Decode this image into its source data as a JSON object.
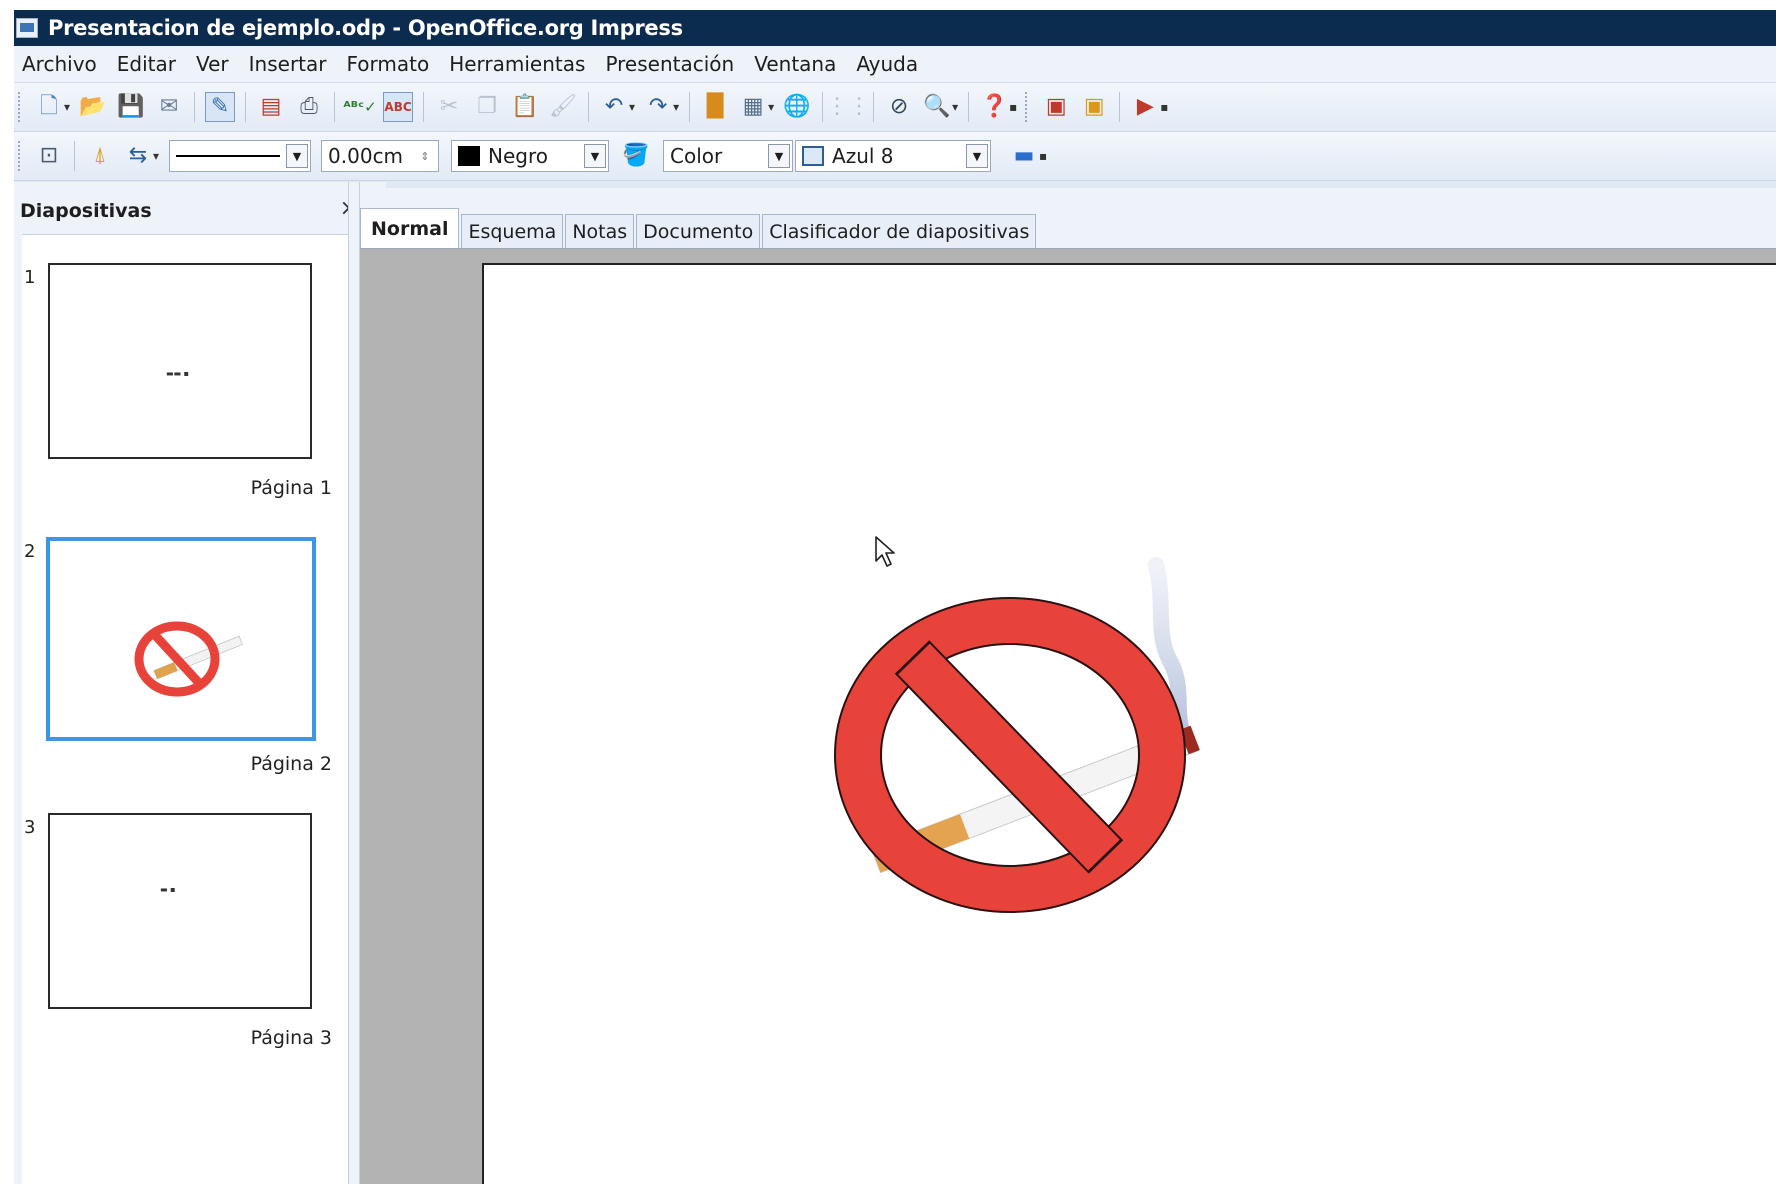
{
  "window": {
    "title": "Presentacion de ejemplo.odp - OpenOffice.org Impress"
  },
  "menu": [
    "Archivo",
    "Editar",
    "Ver",
    "Insertar",
    "Formato",
    "Herramientas",
    "Presentación",
    "Ventana",
    "Ayuda"
  ],
  "line_toolbar": {
    "line_width": "0.00cm",
    "line_color": "Negro",
    "area_style": "Color",
    "area_color": "Azul 8",
    "colors": {
      "line_color_swatch": "#000000",
      "area_color_swatch": "#dbe8f5"
    }
  },
  "panel": {
    "title": "Diapositivas",
    "close": "×",
    "slides": [
      {
        "number": "1",
        "page": "Página 1"
      },
      {
        "number": "2",
        "page": "Página 2"
      },
      {
        "number": "3",
        "page": "Página 3"
      }
    ]
  },
  "tabs": [
    "Normal",
    "Esquema",
    "Notas",
    "Documento",
    "Clasificador de diapositivas"
  ],
  "colors": {
    "titlebar": "#0c2c4f",
    "selection": "#3c95e6",
    "sign_red": "#e8433b"
  }
}
